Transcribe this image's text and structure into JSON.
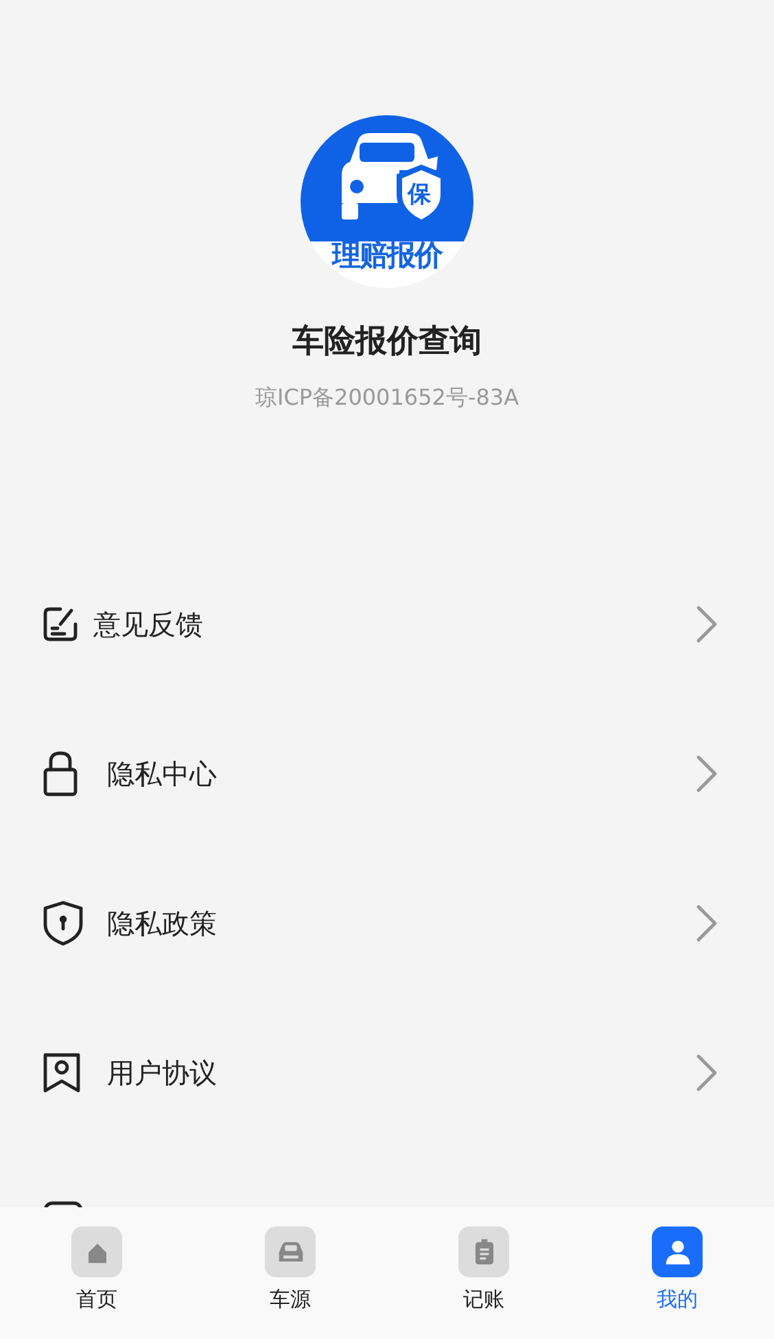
{
  "app": {
    "logo_badge": "保",
    "logo_caption": "理赔报价",
    "title": "车险报价查询",
    "icp": "琼ICP备20001652号-83A"
  },
  "menu": [
    {
      "kind": "feedback",
      "label": "意见反馈"
    },
    {
      "kind": "lock",
      "label": "隐私中心"
    },
    {
      "kind": "shield",
      "label": "隐私政策"
    },
    {
      "kind": "agreement",
      "label": "用户协议"
    },
    {
      "kind": "contact"
    }
  ],
  "tabs": [
    {
      "kind": "home",
      "label": "首页",
      "selected": false
    },
    {
      "kind": "car",
      "label": "车源",
      "selected": false
    },
    {
      "kind": "ledger",
      "label": "记账",
      "selected": false
    },
    {
      "kind": "user",
      "label": "我的",
      "selected": true
    }
  ]
}
